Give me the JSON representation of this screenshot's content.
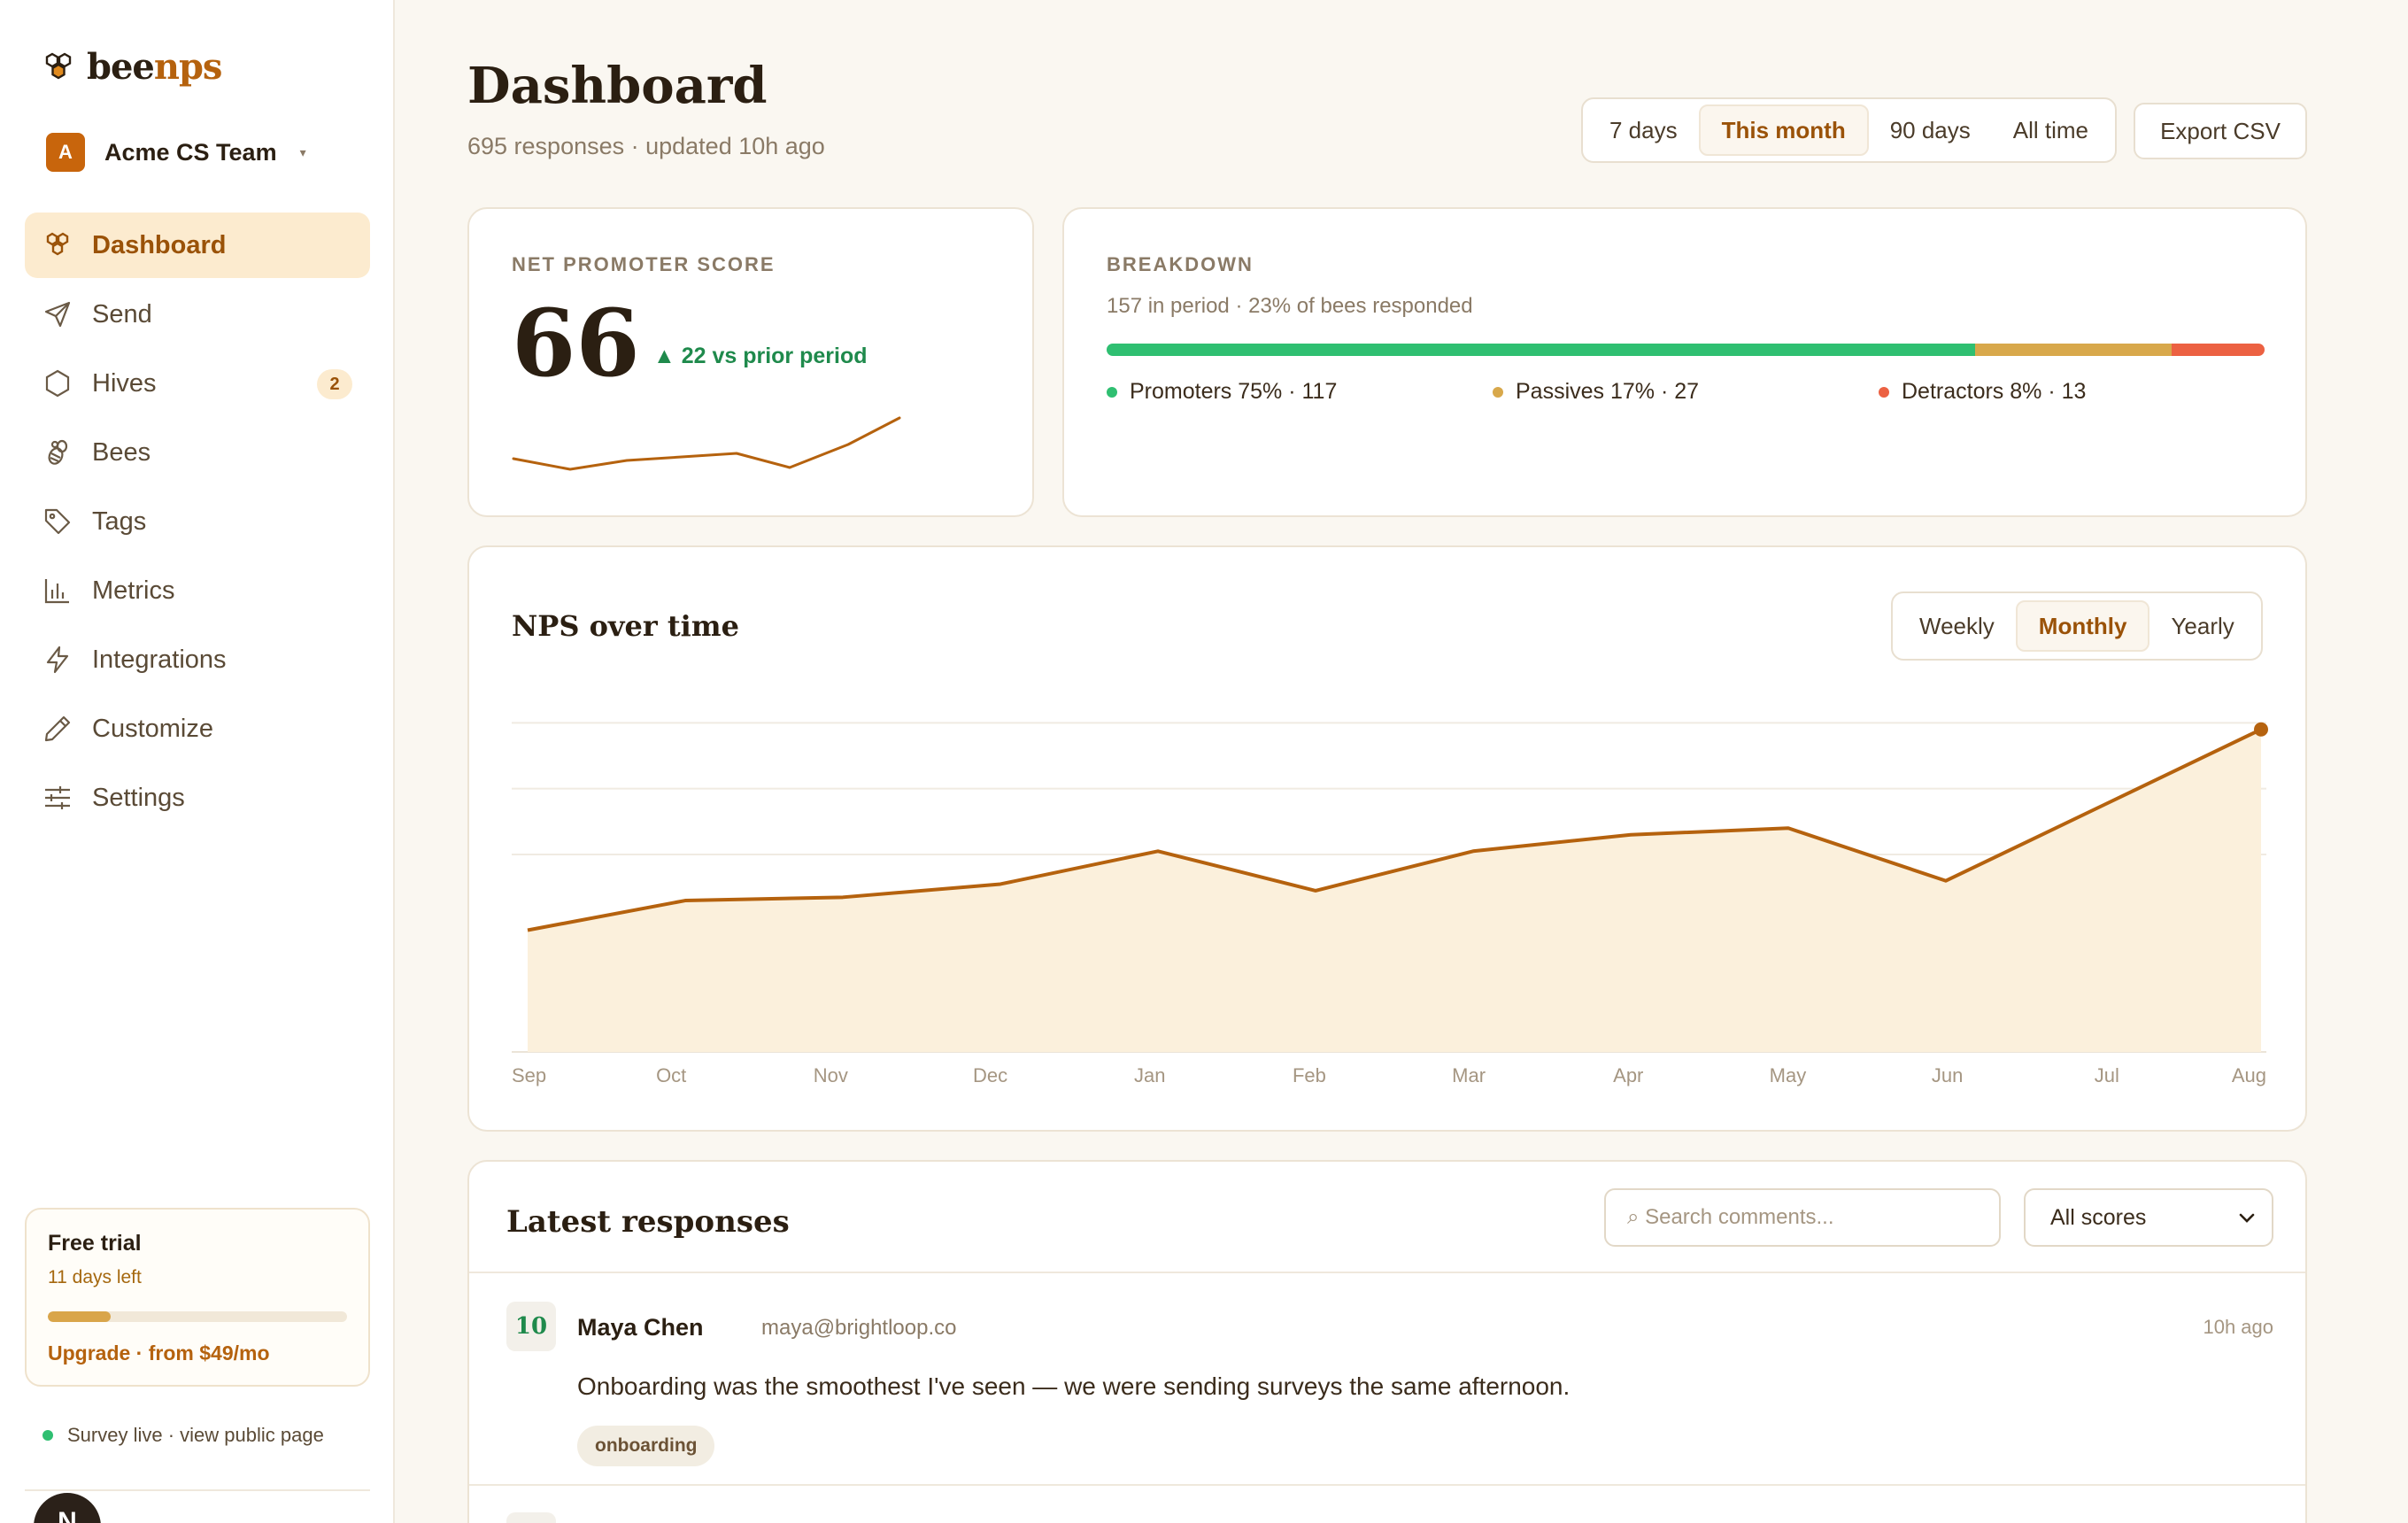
{
  "brand": {
    "name_a": "bee",
    "name_b": "nps"
  },
  "team": {
    "initial": "A",
    "name": "Acme CS Team"
  },
  "nav": {
    "items": [
      {
        "label": "Dashboard",
        "icon": "hive-icon"
      },
      {
        "label": "Send",
        "icon": "send-icon"
      },
      {
        "label": "Hives",
        "icon": "hexagon-icon",
        "badge": "2"
      },
      {
        "label": "Bees",
        "icon": "bee-icon"
      },
      {
        "label": "Tags",
        "icon": "tag-icon"
      },
      {
        "label": "Metrics",
        "icon": "bar-chart-icon"
      },
      {
        "label": "Integrations",
        "icon": "lightning-icon"
      },
      {
        "label": "Customize",
        "icon": "pencil-icon"
      },
      {
        "label": "Settings",
        "icon": "sliders-icon"
      }
    ]
  },
  "trial": {
    "title": "Free trial",
    "days_left": "11 days left",
    "progress": 0.21,
    "upgrade": "Upgrade · from $49/mo"
  },
  "survey": {
    "status": "Survey live · view public page"
  },
  "user": {
    "initial": "N"
  },
  "header": {
    "title": "Dashboard",
    "subtitle": "695 responses · updated 10h ago",
    "ranges": [
      "7 days",
      "This month",
      "90 days",
      "All time"
    ],
    "active_range": "This month",
    "export": "Export CSV"
  },
  "nps": {
    "label": "NET PROMOTER SCORE",
    "value": "66",
    "delta": "▲ 22 vs prior period"
  },
  "breakdown": {
    "label": "BREAKDOWN",
    "subtitle": "157 in period · 23% of bees responded",
    "segments": [
      {
        "label": "Promoters 75% · 117",
        "share": 75,
        "color": "#2fbf71"
      },
      {
        "label": "Passives 17% · 27",
        "share": 17,
        "color": "#d8a84b"
      },
      {
        "label": "Detractors 8% · 13",
        "share": 8,
        "color": "#ec6142"
      }
    ]
  },
  "chart_section": {
    "title": "NPS over time",
    "periods": [
      "Weekly",
      "Monthly",
      "Yearly"
    ],
    "active_period": "Monthly"
  },
  "chart_data": {
    "type": "area",
    "title": "NPS over time",
    "categories": [
      "Sep",
      "Oct",
      "Nov",
      "Dec",
      "Jan",
      "Feb",
      "Mar",
      "Apr",
      "May",
      "Jun",
      "Jul",
      "Aug"
    ],
    "values": [
      37,
      46,
      47,
      51,
      61,
      49,
      61,
      66,
      68,
      52,
      75,
      98
    ],
    "ylim": [
      0,
      120
    ],
    "grid": true,
    "line_color": "#b5620e",
    "fill_color": "#fbf0dc"
  },
  "responses": {
    "title": "Latest responses",
    "search_placeholder": "⌕ Search comments...",
    "filter": "All scores",
    "items": [
      {
        "score": "10",
        "name": "Maya Chen",
        "email": "maya@brightloop.co",
        "time": "10h ago",
        "comment": "Onboarding was the smoothest I've seen — we were sending surveys the same afternoon.",
        "tag": "onboarding"
      }
    ]
  }
}
